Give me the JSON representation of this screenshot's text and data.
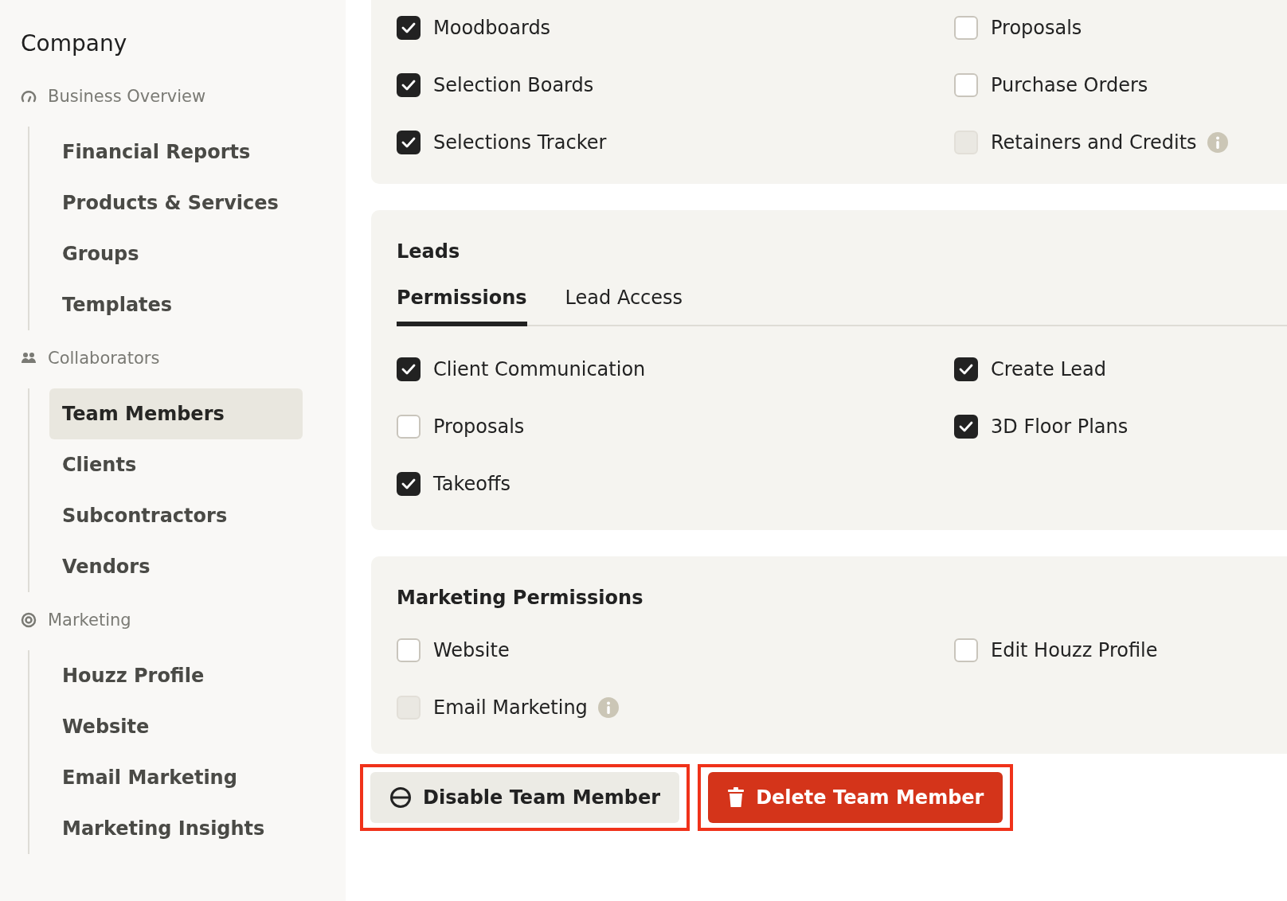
{
  "sidebar": {
    "title": "Company",
    "sections": [
      {
        "label": "Business Overview",
        "items": [
          {
            "label": "Financial Reports",
            "selected": false
          },
          {
            "label": "Products & Services",
            "selected": false
          },
          {
            "label": "Groups",
            "selected": false
          },
          {
            "label": "Templates",
            "selected": false
          }
        ]
      },
      {
        "label": "Collaborators",
        "items": [
          {
            "label": "Team Members",
            "selected": true
          },
          {
            "label": "Clients",
            "selected": false
          },
          {
            "label": "Subcontractors",
            "selected": false
          },
          {
            "label": "Vendors",
            "selected": false
          }
        ]
      },
      {
        "label": "Marketing",
        "items": [
          {
            "label": "Houzz Profile",
            "selected": false
          },
          {
            "label": "Website",
            "selected": false
          },
          {
            "label": "Email Marketing",
            "selected": false
          },
          {
            "label": "Marketing Insights",
            "selected": false
          }
        ]
      }
    ]
  },
  "cards": [
    {
      "permissions": [
        {
          "label": "Moodboards",
          "checked": true,
          "disabled": false,
          "info": false
        },
        {
          "label": "Proposals",
          "checked": false,
          "disabled": false,
          "info": false
        },
        {
          "label": "Selection Boards",
          "checked": true,
          "disabled": false,
          "info": false
        },
        {
          "label": "Purchase Orders",
          "checked": false,
          "disabled": false,
          "info": false
        },
        {
          "label": "Selections Tracker",
          "checked": true,
          "disabled": false,
          "info": false
        },
        {
          "label": "Retainers and Credits",
          "checked": false,
          "disabled": true,
          "info": true
        }
      ]
    },
    {
      "title": "Leads",
      "tabs": [
        {
          "label": "Permissions",
          "selected": true
        },
        {
          "label": "Lead Access",
          "selected": false
        }
      ],
      "permissions": [
        {
          "label": "Client Communication",
          "checked": true,
          "disabled": false,
          "info": false
        },
        {
          "label": "Create Lead",
          "checked": true,
          "disabled": false,
          "info": false
        },
        {
          "label": "Proposals",
          "checked": false,
          "disabled": false,
          "info": false
        },
        {
          "label": "3D Floor Plans",
          "checked": true,
          "disabled": false,
          "info": false
        },
        {
          "label": "Takeoffs",
          "checked": true,
          "disabled": false,
          "info": false
        }
      ]
    },
    {
      "title": "Marketing Permissions",
      "permissions": [
        {
          "label": "Website",
          "checked": false,
          "disabled": false,
          "info": false
        },
        {
          "label": "Edit Houzz Profile",
          "checked": false,
          "disabled": false,
          "info": false
        },
        {
          "label": "Email Marketing",
          "checked": false,
          "disabled": true,
          "info": true
        }
      ]
    }
  ],
  "actions": [
    {
      "label": "Disable Team Member",
      "kind": "disable",
      "highlighted": true
    },
    {
      "label": "Delete Team Member",
      "kind": "delete",
      "highlighted": true
    }
  ]
}
